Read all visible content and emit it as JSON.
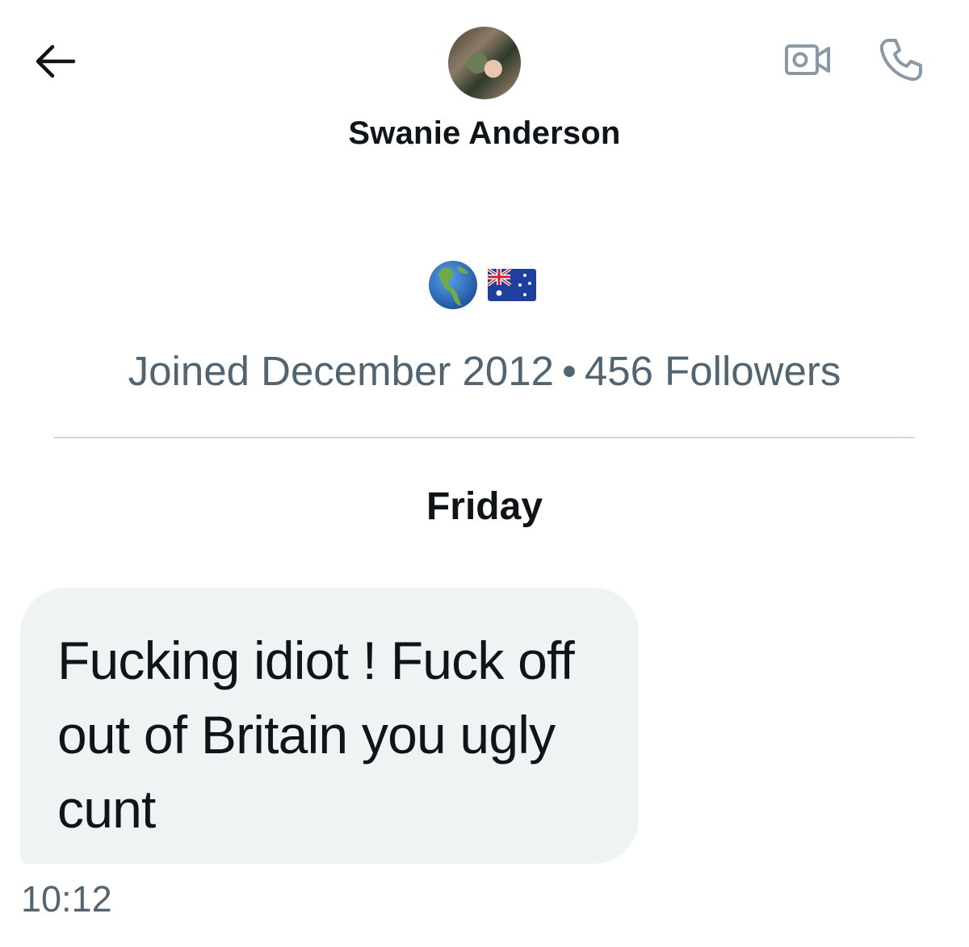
{
  "header": {
    "back_icon": "arrow-left-icon",
    "video_call_icon": "video-camera-icon",
    "phone_call_icon": "phone-icon",
    "icon_color": "#8b98a5"
  },
  "profile": {
    "display_name": "Swanie Anderson",
    "bio_emojis": [
      "globe-americas-emoji",
      "australia-flag-emoji"
    ],
    "joined": "Joined December 2012",
    "separator": "•",
    "followers": "456 Followers"
  },
  "conversation": {
    "day_label": "Friday",
    "messages": [
      {
        "text": "Fucking idiot ! Fuck off out of Britain you ugly cunt",
        "time": "10:12"
      }
    ]
  },
  "colors": {
    "primary_text": "#0f1419",
    "secondary_text": "#536471",
    "bubble_bg": "#eff3f4",
    "divider": "#cfd9de"
  }
}
